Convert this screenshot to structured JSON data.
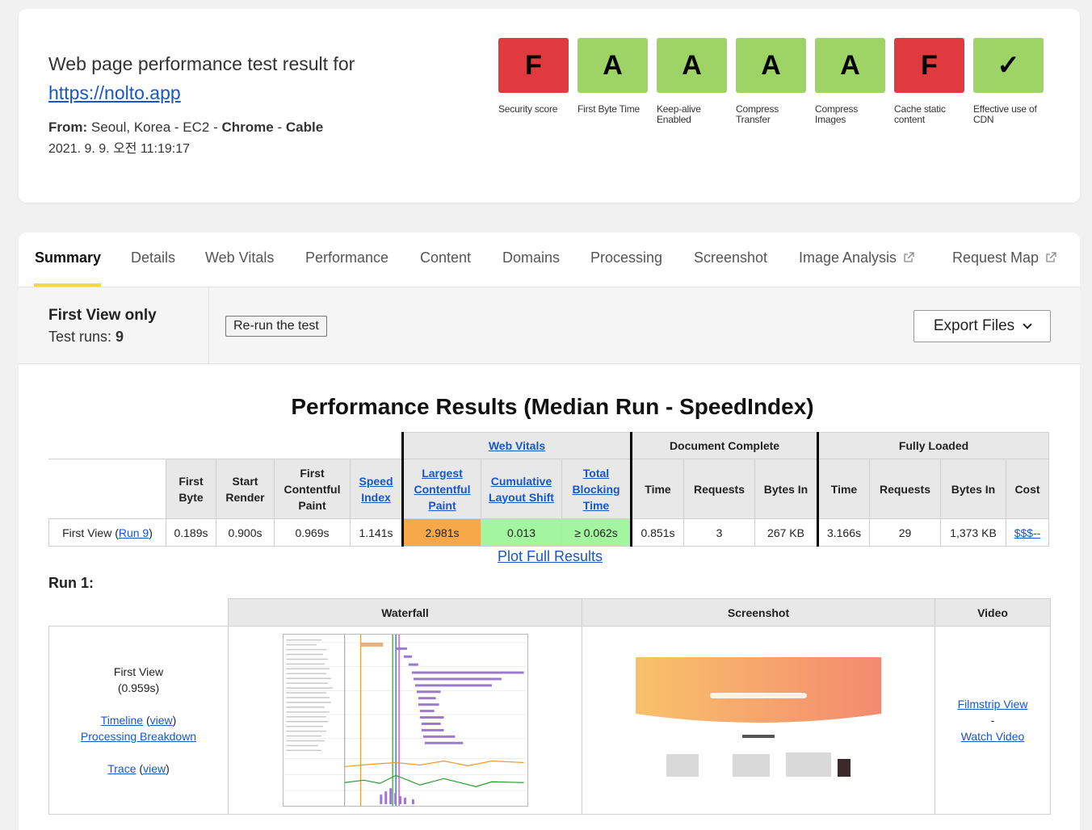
{
  "header": {
    "title": "Web page performance test result for",
    "url": "https://nolto.app",
    "from_label": "From:",
    "from_location": "Seoul, Korea - EC2 -",
    "from_browser": "Chrome",
    "from_sep": "-",
    "from_connection": "Cable",
    "date": "2021. 9. 9. 오전 11:19:17"
  },
  "grades": [
    {
      "grade": "F",
      "label": "Security score",
      "color": "#e03a3e"
    },
    {
      "grade": "A",
      "label": "First Byte Time",
      "color": "#9dd465"
    },
    {
      "grade": "A",
      "label": "Keep-alive Enabled",
      "color": "#9dd465"
    },
    {
      "grade": "A",
      "label": "Compress Transfer",
      "color": "#9dd465"
    },
    {
      "grade": "A",
      "label": "Compress Images",
      "color": "#9dd465"
    },
    {
      "grade": "F",
      "label": "Cache static content",
      "color": "#e03a3e"
    },
    {
      "grade": "✓",
      "label": "Effective use of CDN",
      "color": "#9dd465"
    }
  ],
  "tabs": [
    {
      "label": "Summary",
      "active": true
    },
    {
      "label": "Details"
    },
    {
      "label": "Web Vitals"
    },
    {
      "label": "Performance"
    },
    {
      "label": "Content"
    },
    {
      "label": "Domains"
    },
    {
      "label": "Processing"
    },
    {
      "label": "Screenshot"
    },
    {
      "label": "Image Analysis",
      "external": true
    },
    {
      "label": "Request Map",
      "external": true
    }
  ],
  "runbar": {
    "first_view_only": "First View only",
    "test_runs_label": "Test runs:",
    "test_runs_value": "9",
    "rerun_label": "Re-run the test",
    "export_label": "Export Files"
  },
  "performance": {
    "title": "Performance Results (Median Run - SpeedIndex)",
    "group_headers": {
      "web_vitals": "Web Vitals",
      "document_complete": "Document Complete",
      "fully_loaded": "Fully Loaded"
    },
    "columns": {
      "first_byte": "First Byte",
      "start_render": "Start Render",
      "fcp": "First Contentful Paint",
      "speed_index": "Speed Index",
      "lcp": "Largest Contentful Paint",
      "cls": "Cumulative Layout Shift",
      "tbt": "Total Blocking Time",
      "dc_time": "Time",
      "dc_requests": "Requests",
      "dc_bytes": "Bytes In",
      "fl_time": "Time",
      "fl_requests": "Requests",
      "fl_bytes": "Bytes In",
      "cost": "Cost"
    },
    "row": {
      "label": "First View (",
      "run_link": "Run 9",
      "label_end": ")",
      "first_byte": "0.189s",
      "start_render": "0.900s",
      "fcp": "0.969s",
      "speed_index": "1.141s",
      "lcp": "2.981s",
      "cls": "0.013",
      "tbt": "≥ 0.062s",
      "dc_time": "0.851s",
      "dc_requests": "3",
      "dc_bytes": "267 KB",
      "fl_time": "3.166s",
      "fl_requests": "29",
      "fl_bytes": "1,373 KB",
      "cost": "$$$--"
    },
    "plot_link": "Plot Full Results"
  },
  "run": {
    "label": "Run 1:",
    "headers": {
      "waterfall": "Waterfall",
      "screenshot": "Screenshot",
      "video": "Video"
    },
    "first_view": "First View",
    "first_view_time": "(0.959s)",
    "timeline": "Timeline",
    "timeline_view": "view",
    "processing": "Processing Breakdown",
    "trace": "Trace",
    "trace_view": "view",
    "filmstrip": "Filmstrip View",
    "sep": "-",
    "watch_video": "Watch Video"
  }
}
